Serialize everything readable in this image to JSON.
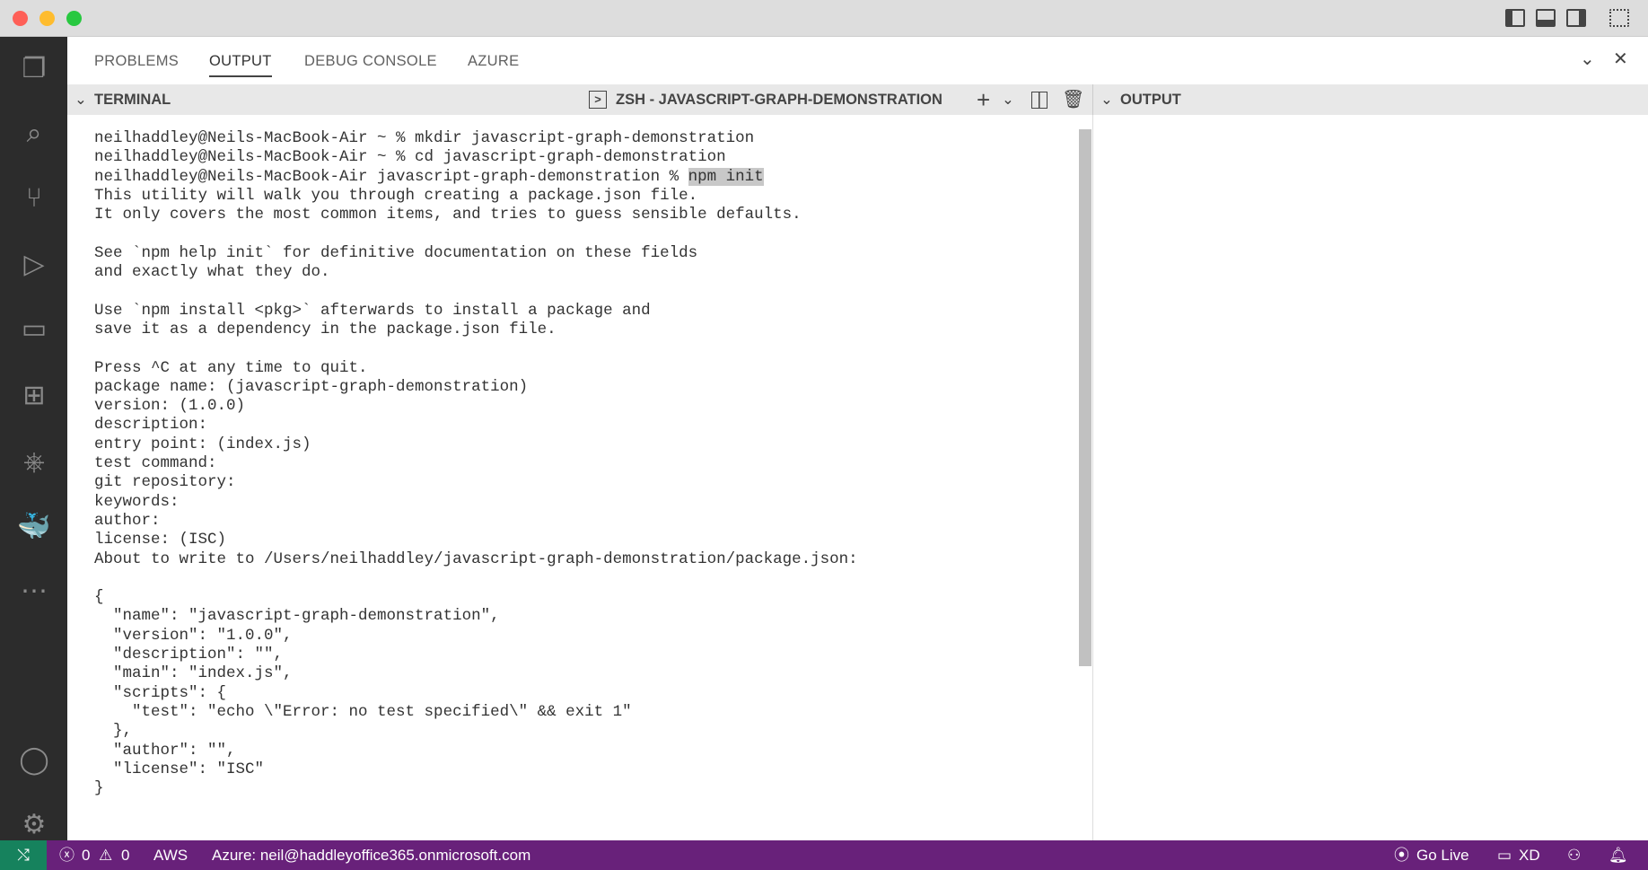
{
  "panel": {
    "tabs": [
      "PROBLEMS",
      "OUTPUT",
      "DEBUG CONSOLE",
      "AZURE"
    ],
    "active_tab": "OUTPUT"
  },
  "terminal": {
    "header": "TERMINAL",
    "session": "ZSH - JAVASCRIPT-GRAPH-DEMONSTRATION",
    "lines_before": "neilhaddley@Neils-MacBook-Air ~ % mkdir javascript-graph-demonstration\nneilhaddley@Neils-MacBook-Air ~ % cd javascript-graph-demonstration\nneilhaddley@Neils-MacBook-Air javascript-graph-demonstration % ",
    "selected": "npm init",
    "lines_after": "\nThis utility will walk you through creating a package.json file.\nIt only covers the most common items, and tries to guess sensible defaults.\n\nSee `npm help init` for definitive documentation on these fields\nand exactly what they do.\n\nUse `npm install <pkg>` afterwards to install a package and\nsave it as a dependency in the package.json file.\n\nPress ^C at any time to quit.\npackage name: (javascript-graph-demonstration)\nversion: (1.0.0)\ndescription:\nentry point: (index.js)\ntest command:\ngit repository:\nkeywords:\nauthor:\nlicense: (ISC)\nAbout to write to /Users/neilhaddley/javascript-graph-demonstration/package.json:\n\n{\n  \"name\": \"javascript-graph-demonstration\",\n  \"version\": \"1.0.0\",\n  \"description\": \"\",\n  \"main\": \"index.js\",\n  \"scripts\": {\n    \"test\": \"echo \\\"Error: no test specified\\\" && exit 1\"\n  },\n  \"author\": \"\",\n  \"license\": \"ISC\"\n}"
  },
  "output": {
    "header": "OUTPUT"
  },
  "status": {
    "errors": "0",
    "warnings": "0",
    "aws": "AWS",
    "azure": "Azure: neil@haddleyoffice365.onmicrosoft.com",
    "golive": "Go Live",
    "xd": "XD"
  }
}
